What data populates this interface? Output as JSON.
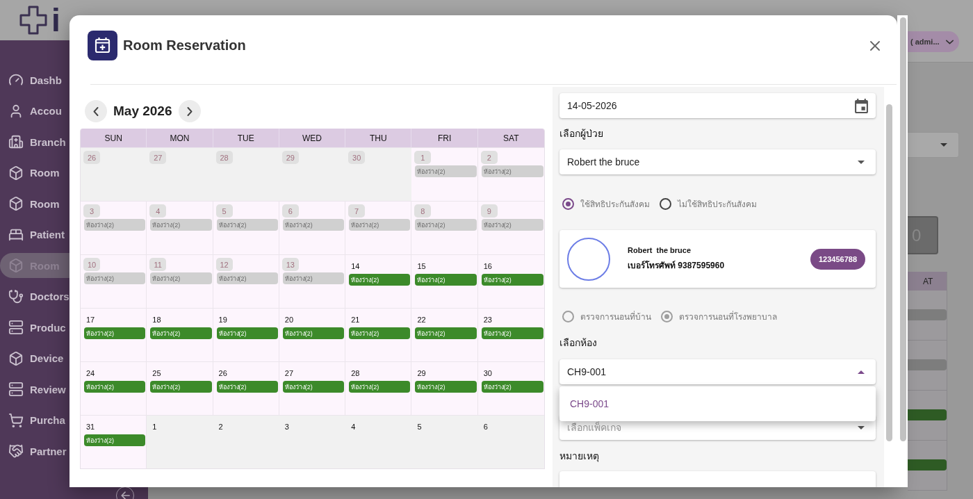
{
  "header": {
    "logo_text": "i",
    "user_menu": "( admi..."
  },
  "sidebar": {
    "items": [
      {
        "label": "Dashb",
        "selected": false
      },
      {
        "label": "Accou",
        "selected": false
      },
      {
        "label": "Branch",
        "selected": false
      },
      {
        "label": "Room",
        "selected": false
      },
      {
        "label": "Room",
        "selected": false
      },
      {
        "label": "Patient",
        "selected": false
      },
      {
        "label": "Room",
        "selected": true
      },
      {
        "label": "Doctors",
        "selected": false
      },
      {
        "label": "Produc",
        "selected": false
      },
      {
        "label": "Device",
        "selected": false
      },
      {
        "label": "Review",
        "selected": false
      },
      {
        "label": "Purcha",
        "selected": false
      },
      {
        "label": "Partner",
        "selected": false
      }
    ]
  },
  "background_panel": {
    "stat_value": "0",
    "calendar_header": "AT",
    "events": [
      {
        "available": false
      },
      {
        "available": false
      },
      {
        "available": true
      },
      {
        "available": true
      }
    ]
  },
  "dialog": {
    "title": "Room Reservation",
    "calendar": {
      "month_label": "May 2026",
      "weekdays": [
        "SUN",
        "MON",
        "TUE",
        "WED",
        "THU",
        "FRI",
        "SAT"
      ],
      "weeks": [
        {
          "days": [
            {
              "day": "26",
              "outside_month": true,
              "past": true
            },
            {
              "day": "27",
              "outside_month": true,
              "past": true
            },
            {
              "day": "28",
              "outside_month": true,
              "past": true
            },
            {
              "day": "29",
              "outside_month": true,
              "past": true
            },
            {
              "day": "30",
              "outside_month": true,
              "past": true
            },
            {
              "day": "1",
              "outside_month": false,
              "past": true,
              "events": [
                {
                  "label": "ห้องว่าง(2)",
                  "available": false
                }
              ]
            },
            {
              "day": "2",
              "outside_month": false,
              "past": true,
              "events": [
                {
                  "label": "ห้องว่าง(2)",
                  "available": false
                }
              ]
            }
          ]
        },
        {
          "days": [
            {
              "day": "3",
              "outside_month": false,
              "past": true,
              "events": [
                {
                  "label": "ห้องว่าง(2)",
                  "available": false
                }
              ]
            },
            {
              "day": "4",
              "outside_month": false,
              "past": true,
              "events": [
                {
                  "label": "ห้องว่าง(2)",
                  "available": false
                }
              ]
            },
            {
              "day": "5",
              "outside_month": false,
              "past": true,
              "events": [
                {
                  "label": "ห้องว่าง(2)",
                  "available": false
                }
              ]
            },
            {
              "day": "6",
              "outside_month": false,
              "past": true,
              "events": [
                {
                  "label": "ห้องว่าง(2)",
                  "available": false
                }
              ]
            },
            {
              "day": "7",
              "outside_month": false,
              "past": true,
              "events": [
                {
                  "label": "ห้องว่าง(2)",
                  "available": false
                }
              ]
            },
            {
              "day": "8",
              "outside_month": false,
              "past": true,
              "events": [
                {
                  "label": "ห้องว่าง(2)",
                  "available": false
                }
              ]
            },
            {
              "day": "9",
              "outside_month": false,
              "past": true,
              "events": [
                {
                  "label": "ห้องว่าง(2)",
                  "available": false
                }
              ]
            }
          ]
        },
        {
          "days": [
            {
              "day": "10",
              "outside_month": false,
              "past": true,
              "events": [
                {
                  "label": "ห้องว่าง(2)",
                  "available": false
                }
              ]
            },
            {
              "day": "11",
              "outside_month": false,
              "past": true,
              "events": [
                {
                  "label": "ห้องว่าง(2)",
                  "available": false
                }
              ]
            },
            {
              "day": "12",
              "outside_month": false,
              "past": true,
              "events": [
                {
                  "label": "ห้องว่าง(2)",
                  "available": false
                }
              ]
            },
            {
              "day": "13",
              "outside_month": false,
              "past": true,
              "events": [
                {
                  "label": "ห้องว่าง(2)",
                  "available": false
                }
              ]
            },
            {
              "day": "14",
              "outside_month": false,
              "past": false,
              "events": [
                {
                  "label": "ห้องว่าง(2)",
                  "available": true
                }
              ]
            },
            {
              "day": "15",
              "outside_month": false,
              "past": false,
              "events": [
                {
                  "label": "ห้องว่าง(2)",
                  "available": true
                }
              ]
            },
            {
              "day": "16",
              "outside_month": false,
              "past": false,
              "events": [
                {
                  "label": "ห้องว่าง(2)",
                  "available": true
                }
              ]
            }
          ]
        },
        {
          "days": [
            {
              "day": "17",
              "outside_month": false,
              "past": false,
              "events": [
                {
                  "label": "ห้องว่าง(2)",
                  "available": true
                }
              ]
            },
            {
              "day": "18",
              "outside_month": false,
              "past": false,
              "events": [
                {
                  "label": "ห้องว่าง(2)",
                  "available": true
                }
              ]
            },
            {
              "day": "19",
              "outside_month": false,
              "past": false,
              "events": [
                {
                  "label": "ห้องว่าง(2)",
                  "available": true
                }
              ]
            },
            {
              "day": "20",
              "outside_month": false,
              "past": false,
              "events": [
                {
                  "label": "ห้องว่าง(2)",
                  "available": true
                }
              ]
            },
            {
              "day": "21",
              "outside_month": false,
              "past": false,
              "events": [
                {
                  "label": "ห้องว่าง(2)",
                  "available": true
                }
              ]
            },
            {
              "day": "22",
              "outside_month": false,
              "past": false,
              "events": [
                {
                  "label": "ห้องว่าง(2)",
                  "available": true
                }
              ]
            },
            {
              "day": "23",
              "outside_month": false,
              "past": false,
              "events": [
                {
                  "label": "ห้องว่าง(2)",
                  "available": true
                }
              ]
            }
          ]
        },
        {
          "days": [
            {
              "day": "24",
              "outside_month": false,
              "past": false,
              "events": [
                {
                  "label": "ห้องว่าง(2)",
                  "available": true
                }
              ]
            },
            {
              "day": "25",
              "outside_month": false,
              "past": false,
              "events": [
                {
                  "label": "ห้องว่าง(2)",
                  "available": true
                }
              ]
            },
            {
              "day": "26",
              "outside_month": false,
              "past": false,
              "events": [
                {
                  "label": "ห้องว่าง(2)",
                  "available": true
                }
              ]
            },
            {
              "day": "27",
              "outside_month": false,
              "past": false,
              "events": [
                {
                  "label": "ห้องว่าง(2)",
                  "available": true
                }
              ]
            },
            {
              "day": "28",
              "outside_month": false,
              "past": false,
              "events": [
                {
                  "label": "ห้องว่าง(2)",
                  "available": true
                }
              ]
            },
            {
              "day": "29",
              "outside_month": false,
              "past": false,
              "events": [
                {
                  "label": "ห้องว่าง(2)",
                  "available": true
                }
              ]
            },
            {
              "day": "30",
              "outside_month": false,
              "past": false,
              "events": [
                {
                  "label": "ห้องว่าง(2)",
                  "available": true
                }
              ]
            }
          ]
        },
        {
          "days": [
            {
              "day": "31",
              "outside_month": false,
              "past": false,
              "events": [
                {
                  "label": "ห้องว่าง(2)",
                  "available": true
                }
              ]
            },
            {
              "day": "1",
              "outside_month": true,
              "past": false
            },
            {
              "day": "2",
              "outside_month": true,
              "past": false
            },
            {
              "day": "3",
              "outside_month": true,
              "past": false
            },
            {
              "day": "4",
              "outside_month": true,
              "past": false
            },
            {
              "day": "5",
              "outside_month": true,
              "past": false
            },
            {
              "day": "6",
              "outside_month": true,
              "past": false
            }
          ]
        }
      ]
    },
    "form": {
      "date_field": {
        "value": "14-05-2026"
      },
      "patient_label": "เลือกผู้ป่วย",
      "patient_select": {
        "value": "Robert the bruce",
        "expanded": false
      },
      "insurance_options": [
        {
          "label": "ใช้สิทธิประกันสังคม",
          "selected": true
        },
        {
          "label": "ไม่ใช้สิทธิประกันสังคม",
          "selected": false
        }
      ],
      "patient_card": {
        "name": "Robert  the bruce",
        "phone": "เบอร์โทรศัพท์ 9387595960",
        "badge": "123456788"
      },
      "exam_options": {
        "disabled": true,
        "options": [
          {
            "label": "ตรวจการนอนที่บ้าน",
            "selected": false
          },
          {
            "label": "ตรวจการนอนที่โรงพยาบาล",
            "selected": true
          }
        ]
      },
      "room_label": "เลือกห้อง",
      "room_select": {
        "value": "CH9-001",
        "expanded": true,
        "options": [
          {
            "label": "CH9-001",
            "selected": true
          }
        ]
      },
      "package_select": {
        "placeholder": "เลือกแพ็คเกจ"
      },
      "note_label": "หมายเหตุ"
    }
  }
}
